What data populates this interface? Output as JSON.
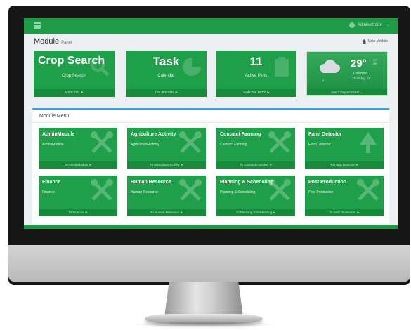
{
  "header": {
    "user_name": "Administrator"
  },
  "page": {
    "title": "Module",
    "subtitle": "Panel",
    "breadcrumb": "Main Module"
  },
  "stats": [
    {
      "big": "Crop Search",
      "small": "Crop Search",
      "footer": "More info"
    },
    {
      "big": "Task",
      "small": "Calendar",
      "footer": "To Calendar"
    },
    {
      "big": "11",
      "small": "Active Plots",
      "footer": "To Active Plots"
    }
  ],
  "weather": {
    "temperature": "29°",
    "high": "29°",
    "low": "28°",
    "city": "Colombo",
    "date": "Thursday, 02",
    "rain": "0",
    "footer": "See 7 Day Forecast"
  },
  "module_menu": {
    "title": "Module Menu",
    "cards": [
      {
        "title": "AdminModule",
        "subtitle": "AdminModule",
        "footer": "To AdminModule",
        "icon": "tools-icon"
      },
      {
        "title": "Agriculture Activity",
        "subtitle": "Agriculture Activity",
        "footer": "To Agriculture Activity",
        "icon": "tools-icon"
      },
      {
        "title": "Contract Farming",
        "subtitle": "Contract Farming",
        "footer": "To Contract Farming",
        "icon": "tools-icon"
      },
      {
        "title": "Farm Detector",
        "subtitle": "Farm Detector",
        "footer": "To Farm Detector",
        "icon": "tree-icon"
      },
      {
        "title": "Finance",
        "subtitle": "Finance",
        "footer": "To Finance",
        "icon": "tools-icon"
      },
      {
        "title": "Human Resource",
        "subtitle": "Human Resource",
        "footer": "To Human Resource",
        "icon": "tools-icon"
      },
      {
        "title": "Planning & Scheduling",
        "subtitle": "Planning & Scheduling",
        "footer": "To Planning & Scheduling",
        "icon": "tools-icon"
      },
      {
        "title": "Post Production",
        "subtitle": "Post Production",
        "footer": "To Post Production",
        "icon": "tools-icon"
      }
    ]
  },
  "colors": {
    "primary_green": "#1f9f4a",
    "footer_green": "#178a3c",
    "panel_accent": "#36a3d9"
  }
}
